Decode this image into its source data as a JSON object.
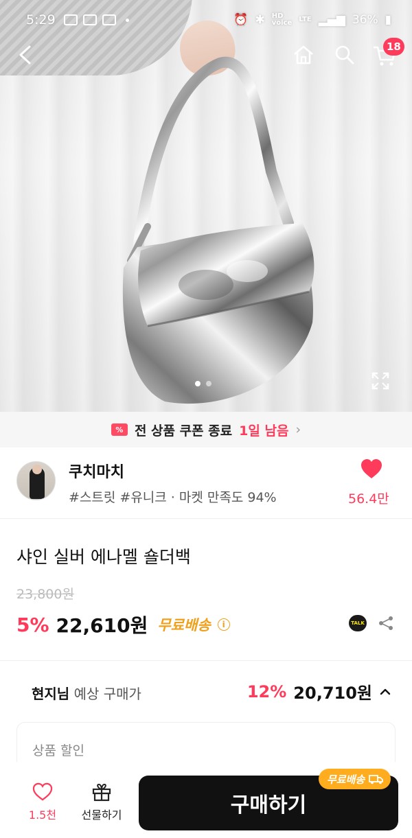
{
  "status_bar": {
    "time": "5:29",
    "network": "LTE",
    "battery": "36%"
  },
  "top_nav": {
    "cart_badge": "18"
  },
  "coupon_banner": {
    "ticket": "%",
    "text": "전 상품 쿠폰 종료",
    "remaining": "1일 남음"
  },
  "shop": {
    "name": "쿠치마치",
    "tags": "#스트릿 #유니크 · 마켓 만족도 94%",
    "likes": "56.4만"
  },
  "product": {
    "title": "샤인 실버 에나멜 숄더백",
    "original_price": "23,800원",
    "discount_rate": "5%",
    "price": "22,610원",
    "shipping": "무료배송",
    "talk_label": "TALK"
  },
  "expected_price": {
    "user": "현지님",
    "label": "예상 구매가",
    "discount_rate": "12%",
    "price": "20,710원"
  },
  "discount_section": {
    "label": "상품 할인"
  },
  "bottom_bar": {
    "like_count": "1.5천",
    "gift_label": "선물하기",
    "buy_label": "구매하기",
    "shipping_badge": "무료배송"
  },
  "colors": {
    "accent": "#ff3b5c",
    "shipping": "#f0a11c",
    "button": "#111111"
  }
}
